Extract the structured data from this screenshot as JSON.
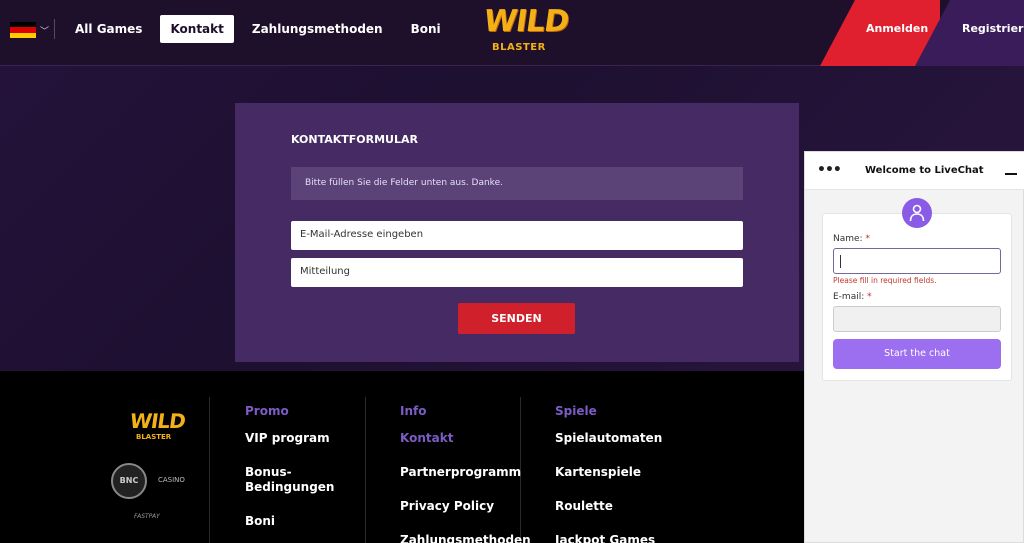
{
  "header": {
    "nav": [
      "All Games",
      "Kontakt",
      "Zahlungsmethoden",
      "Boni"
    ],
    "active_nav": "Kontakt",
    "logo_top": "WILD",
    "logo_bottom": "BLASTER",
    "login": "Anmelden",
    "register": "Registrieren",
    "flag_colors": [
      "#000000",
      "#dd0000",
      "#ffce00"
    ],
    "language_icon": "germany-flag-icon"
  },
  "form": {
    "title": "KONTAKTFORMULAR",
    "note": "Bitte füllen Sie die Felder unten aus. Danke.",
    "email_placeholder": "E-Mail-Adresse eingeben",
    "message_placeholder": "Mitteilung",
    "send": "SENDEN"
  },
  "footer": {
    "logo_top": "WILD",
    "logo_bottom": "BLASTER",
    "badges": [
      "BNC",
      "CASINO",
      "FASTPAY"
    ],
    "columns": [
      {
        "head": "Promo",
        "items": [
          "VIP program",
          "Bonus-Bedingungen",
          "Boni"
        ]
      },
      {
        "head": "Info",
        "items": [
          "Kontakt",
          "Partnerprogramm",
          "Privacy Policy",
          "Zahlungsmethoden"
        ]
      },
      {
        "head": "Spiele",
        "items": [
          "Spielautomaten",
          "Kartenspiele",
          "Roulette",
          "Jackpot Games"
        ]
      }
    ]
  },
  "chat": {
    "menu": "•••",
    "title": "Welcome to LiveChat",
    "name_label": "Name:",
    "email_label": "E-mail:",
    "required_mark": "*",
    "error": "Please fill in required fields.",
    "start": "Start the chat"
  },
  "colors": {
    "accent_red": "#d0202c",
    "accent_purple": "#7c5cc4",
    "chat_button": "#9b6ff0"
  }
}
